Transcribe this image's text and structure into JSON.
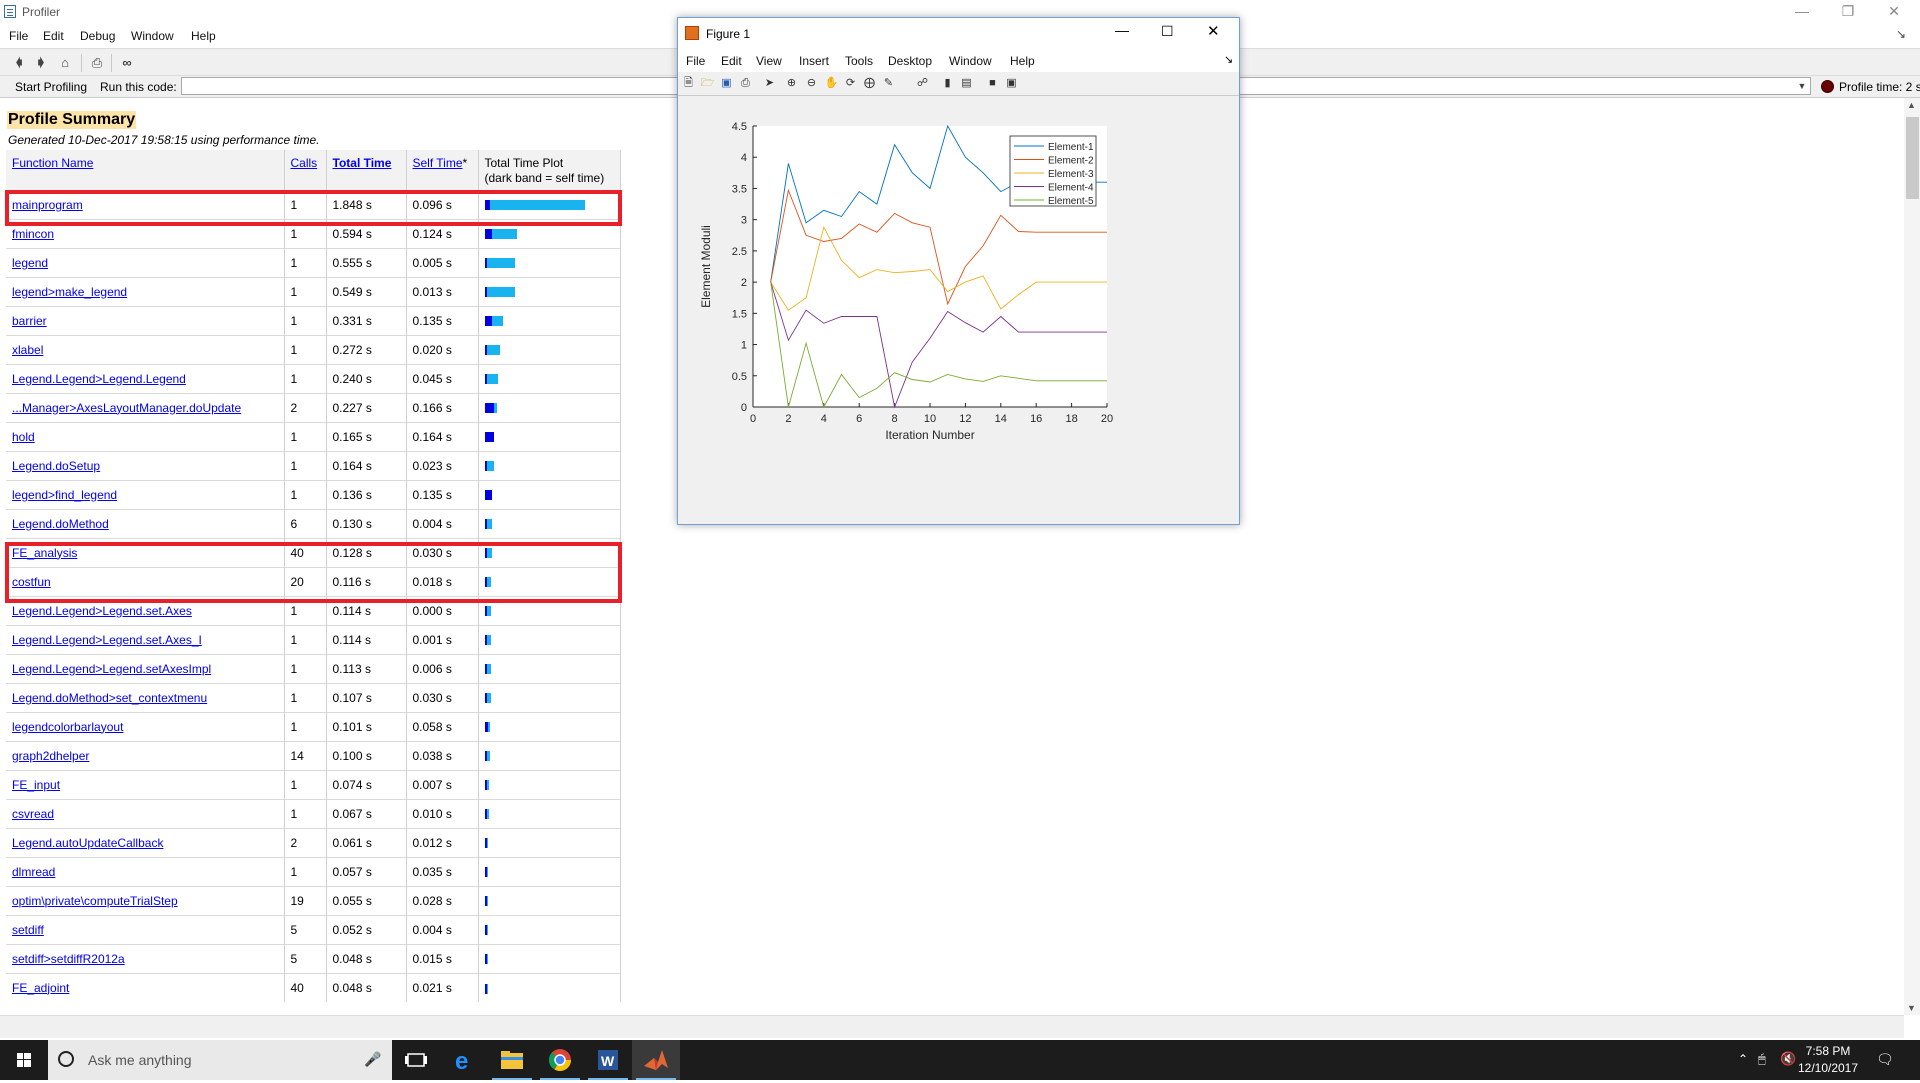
{
  "window": {
    "title": "Profiler",
    "controls": [
      "minimize-icon",
      "restore-icon",
      "close-icon"
    ]
  },
  "menu": [
    "File",
    "Edit",
    "Debug",
    "Window",
    "Help"
  ],
  "toolbar_icons": [
    "back-arrow-icon",
    "forward-arrow-icon",
    "home-icon",
    "print-icon",
    "find-binoculars-icon"
  ],
  "runbar": {
    "start_label": "Start Profiling",
    "run_label": "Run this code:",
    "code_value": "",
    "profile_time": "Profile time: 2 s"
  },
  "summary": {
    "title": "Profile Summary",
    "generated": "Generated 10-Dec-2017 19:58:15 using performance time."
  },
  "table": {
    "headers": {
      "function_name": "Function Name",
      "calls": "Calls",
      "total_time": "Total Time",
      "self_time": "Self Time",
      "self_time_mark": "*",
      "plot_line1": "Total Time Plot",
      "plot_line2": "(dark band = self time)"
    },
    "rows": [
      {
        "name": "mainprogram",
        "calls": "1",
        "total": "1.848 s",
        "self": "0.096 s",
        "total_s": 1.848,
        "self_s": 0.096
      },
      {
        "name": "fmincon",
        "calls": "1",
        "total": "0.594 s",
        "self": "0.124 s",
        "total_s": 0.594,
        "self_s": 0.124
      },
      {
        "name": "legend",
        "calls": "1",
        "total": "0.555 s",
        "self": "0.005 s",
        "total_s": 0.555,
        "self_s": 0.005
      },
      {
        "name": "legend>make_legend",
        "calls": "1",
        "total": "0.549 s",
        "self": "0.013 s",
        "total_s": 0.549,
        "self_s": 0.013
      },
      {
        "name": "barrier",
        "calls": "1",
        "total": "0.331 s",
        "self": "0.135 s",
        "total_s": 0.331,
        "self_s": 0.135
      },
      {
        "name": "xlabel",
        "calls": "1",
        "total": "0.272 s",
        "self": "0.020 s",
        "total_s": 0.272,
        "self_s": 0.02
      },
      {
        "name": "Legend.Legend>Legend.Legend",
        "calls": "1",
        "total": "0.240 s",
        "self": "0.045 s",
        "total_s": 0.24,
        "self_s": 0.045
      },
      {
        "name": "...Manager>AxesLayoutManager.doUpdate",
        "calls": "2",
        "total": "0.227 s",
        "self": "0.166 s",
        "total_s": 0.227,
        "self_s": 0.166
      },
      {
        "name": "hold",
        "calls": "1",
        "total": "0.165 s",
        "self": "0.164 s",
        "total_s": 0.165,
        "self_s": 0.164
      },
      {
        "name": "Legend.doSetup",
        "calls": "1",
        "total": "0.164 s",
        "self": "0.023 s",
        "total_s": 0.164,
        "self_s": 0.023
      },
      {
        "name": "legend>find_legend",
        "calls": "1",
        "total": "0.136 s",
        "self": "0.135 s",
        "total_s": 0.136,
        "self_s": 0.135
      },
      {
        "name": "Legend.doMethod",
        "calls": "6",
        "total": "0.130 s",
        "self": "0.004 s",
        "total_s": 0.13,
        "self_s": 0.004
      },
      {
        "name": "FE_analysis",
        "calls": "40",
        "total": "0.128 s",
        "self": "0.030 s",
        "total_s": 0.128,
        "self_s": 0.03
      },
      {
        "name": "costfun",
        "calls": "20",
        "total": "0.116 s",
        "self": "0.018 s",
        "total_s": 0.116,
        "self_s": 0.018
      },
      {
        "name": "Legend.Legend>Legend.set.Axes",
        "calls": "1",
        "total": "0.114 s",
        "self": "0.000 s",
        "total_s": 0.114,
        "self_s": 0.0
      },
      {
        "name": "Legend.Legend>Legend.set.Axes_I",
        "calls": "1",
        "total": "0.114 s",
        "self": "0.001 s",
        "total_s": 0.114,
        "self_s": 0.001
      },
      {
        "name": "Legend.Legend>Legend.setAxesImpl",
        "calls": "1",
        "total": "0.113 s",
        "self": "0.006 s",
        "total_s": 0.113,
        "self_s": 0.006
      },
      {
        "name": "Legend.doMethod>set_contextmenu",
        "calls": "1",
        "total": "0.107 s",
        "self": "0.030 s",
        "total_s": 0.107,
        "self_s": 0.03
      },
      {
        "name": "legendcolorbarlayout",
        "calls": "1",
        "total": "0.101 s",
        "self": "0.058 s",
        "total_s": 0.101,
        "self_s": 0.058
      },
      {
        "name": "graph2dhelper",
        "calls": "14",
        "total": "0.100 s",
        "self": "0.038 s",
        "total_s": 0.1,
        "self_s": 0.038
      },
      {
        "name": "FE_input",
        "calls": "1",
        "total": "0.074 s",
        "self": "0.007 s",
        "total_s": 0.074,
        "self_s": 0.007
      },
      {
        "name": "csvread",
        "calls": "1",
        "total": "0.067 s",
        "self": "0.010 s",
        "total_s": 0.067,
        "self_s": 0.01
      },
      {
        "name": "Legend.autoUpdateCallback",
        "calls": "2",
        "total": "0.061 s",
        "self": "0.012 s",
        "total_s": 0.061,
        "self_s": 0.012
      },
      {
        "name": "dlmread",
        "calls": "1",
        "total": "0.057 s",
        "self": "0.035 s",
        "total_s": 0.057,
        "self_s": 0.035
      },
      {
        "name": "optim\\private\\computeTrialStep",
        "calls": "19",
        "total": "0.055 s",
        "self": "0.028 s",
        "total_s": 0.055,
        "self_s": 0.028
      },
      {
        "name": "setdiff",
        "calls": "5",
        "total": "0.052 s",
        "self": "0.004 s",
        "total_s": 0.052,
        "self_s": 0.004
      },
      {
        "name": "setdiff>setdiffR2012a",
        "calls": "5",
        "total": "0.048 s",
        "self": "0.015 s",
        "total_s": 0.048,
        "self_s": 0.015
      },
      {
        "name": "FE_adjoint",
        "calls": "40",
        "total": "0.048 s",
        "self": "0.021 s",
        "total_s": 0.048,
        "self_s": 0.021
      }
    ],
    "highlighted_rows": [
      "mainprogram",
      "FE_analysis",
      "costfun"
    ],
    "bar_colors": {
      "total": "#19b3f0",
      "self": "#0000e0"
    }
  },
  "figure": {
    "title": "Figure 1",
    "menu": [
      "File",
      "Edit",
      "View",
      "Insert",
      "Tools",
      "Desktop",
      "Window",
      "Help"
    ],
    "toolbar_icons": [
      "new-figure-icon",
      "open-file-icon",
      "save-icon",
      "print-icon",
      "pointer-icon",
      "zoom-in-icon",
      "zoom-out-icon",
      "pan-icon",
      "rotate-3d-icon",
      "data-cursor-icon",
      "brush-icon",
      "link-plot-icon",
      "insert-colorbar-icon",
      "insert-legend-icon",
      "hide-plot-tools-icon",
      "show-plot-tools-icon"
    ]
  },
  "chart_data": {
    "type": "line",
    "title": "",
    "xlabel": "Iteration Number",
    "ylabel": "Element Moduli",
    "xlim": [
      0,
      20
    ],
    "ylim": [
      0,
      4.5
    ],
    "xticks": [
      0,
      2,
      4,
      6,
      8,
      10,
      12,
      14,
      16,
      18,
      20
    ],
    "yticks": [
      0,
      0.5,
      1,
      1.5,
      2,
      2.5,
      3,
      3.5,
      4,
      4.5
    ],
    "grid": false,
    "legend_position": "top-right",
    "x": [
      1,
      2,
      3,
      4,
      5,
      6,
      7,
      8,
      9,
      10,
      11,
      12,
      13,
      14,
      15,
      16,
      17,
      18,
      19,
      20
    ],
    "series": [
      {
        "name": "Element-1",
        "color": "#0072bd",
        "values": [
          2.0,
          3.9,
          2.95,
          3.15,
          3.05,
          3.45,
          3.25,
          4.2,
          3.75,
          3.5,
          4.5,
          4.0,
          3.75,
          3.45,
          3.6,
          3.6,
          3.6,
          3.6,
          3.6,
          3.6
        ]
      },
      {
        "name": "Element-2",
        "color": "#d95319",
        "values": [
          2.0,
          3.47,
          2.75,
          2.65,
          2.7,
          2.93,
          2.8,
          3.1,
          2.95,
          2.88,
          1.65,
          2.25,
          2.58,
          3.07,
          2.81,
          2.8,
          2.8,
          2.8,
          2.8,
          2.8
        ]
      },
      {
        "name": "Element-3",
        "color": "#edb120",
        "values": [
          2.0,
          1.55,
          1.75,
          2.88,
          2.35,
          2.07,
          2.2,
          2.15,
          2.17,
          2.2,
          1.85,
          2.0,
          2.1,
          1.57,
          1.8,
          2.0,
          2.0,
          2.0,
          2.0,
          2.0
        ]
      },
      {
        "name": "Element-4",
        "color": "#7e2f8e",
        "values": [
          2.0,
          1.07,
          1.55,
          1.34,
          1.45,
          1.45,
          1.45,
          0.0,
          0.72,
          1.1,
          1.53,
          1.35,
          1.2,
          1.45,
          1.2,
          1.2,
          1.2,
          1.2,
          1.2,
          1.2
        ]
      },
      {
        "name": "Element-5",
        "color": "#77ac30",
        "values": [
          2.0,
          0.0,
          1.02,
          0.0,
          0.52,
          0.15,
          0.3,
          0.55,
          0.44,
          0.4,
          0.52,
          0.45,
          0.41,
          0.5,
          0.46,
          0.42,
          0.42,
          0.42,
          0.42,
          0.42
        ]
      }
    ]
  },
  "taskbar": {
    "search_placeholder": "Ask me anything",
    "apps": [
      "task-view-icon",
      "edge-icon",
      "file-explorer-icon",
      "chrome-icon",
      "word-icon",
      "matlab-icon"
    ],
    "time": "7:58 PM",
    "date": "12/10/2017"
  }
}
